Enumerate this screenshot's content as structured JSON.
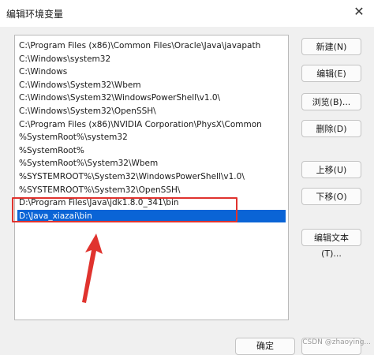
{
  "window": {
    "title": "编辑环境变量",
    "close_glyph": "✕"
  },
  "paths": [
    "C:\\Program Files (x86)\\Common Files\\Oracle\\Java\\javapath",
    "C:\\Windows\\system32",
    "C:\\Windows",
    "C:\\Windows\\System32\\Wbem",
    "C:\\Windows\\System32\\WindowsPowerShell\\v1.0\\",
    "C:\\Windows\\System32\\OpenSSH\\",
    "C:\\Program Files (x86)\\NVIDIA Corporation\\PhysX\\Common",
    "%SystemRoot%\\system32",
    "%SystemRoot%",
    "%SystemRoot%\\System32\\Wbem",
    "%SYSTEMROOT%\\System32\\WindowsPowerShell\\v1.0\\",
    "%SYSTEMROOT%\\System32\\OpenSSH\\",
    "D:\\Program Files\\Java\\jdk1.8.0_341\\bin",
    "D:\\Java_xiazai\\bin"
  ],
  "selected_index": 13,
  "buttons": {
    "new": "新建(N)",
    "edit": "编辑(E)",
    "browse": "浏览(B)...",
    "delete": "删除(D)",
    "move_up": "上移(U)",
    "move_down": "下移(O)",
    "edit_text": "编辑文本(T)...",
    "ok": "确定"
  },
  "watermark": "CSDN @zhaoying...",
  "colors": {
    "selection": "#0a64d6",
    "annotation": "#e0332e"
  }
}
